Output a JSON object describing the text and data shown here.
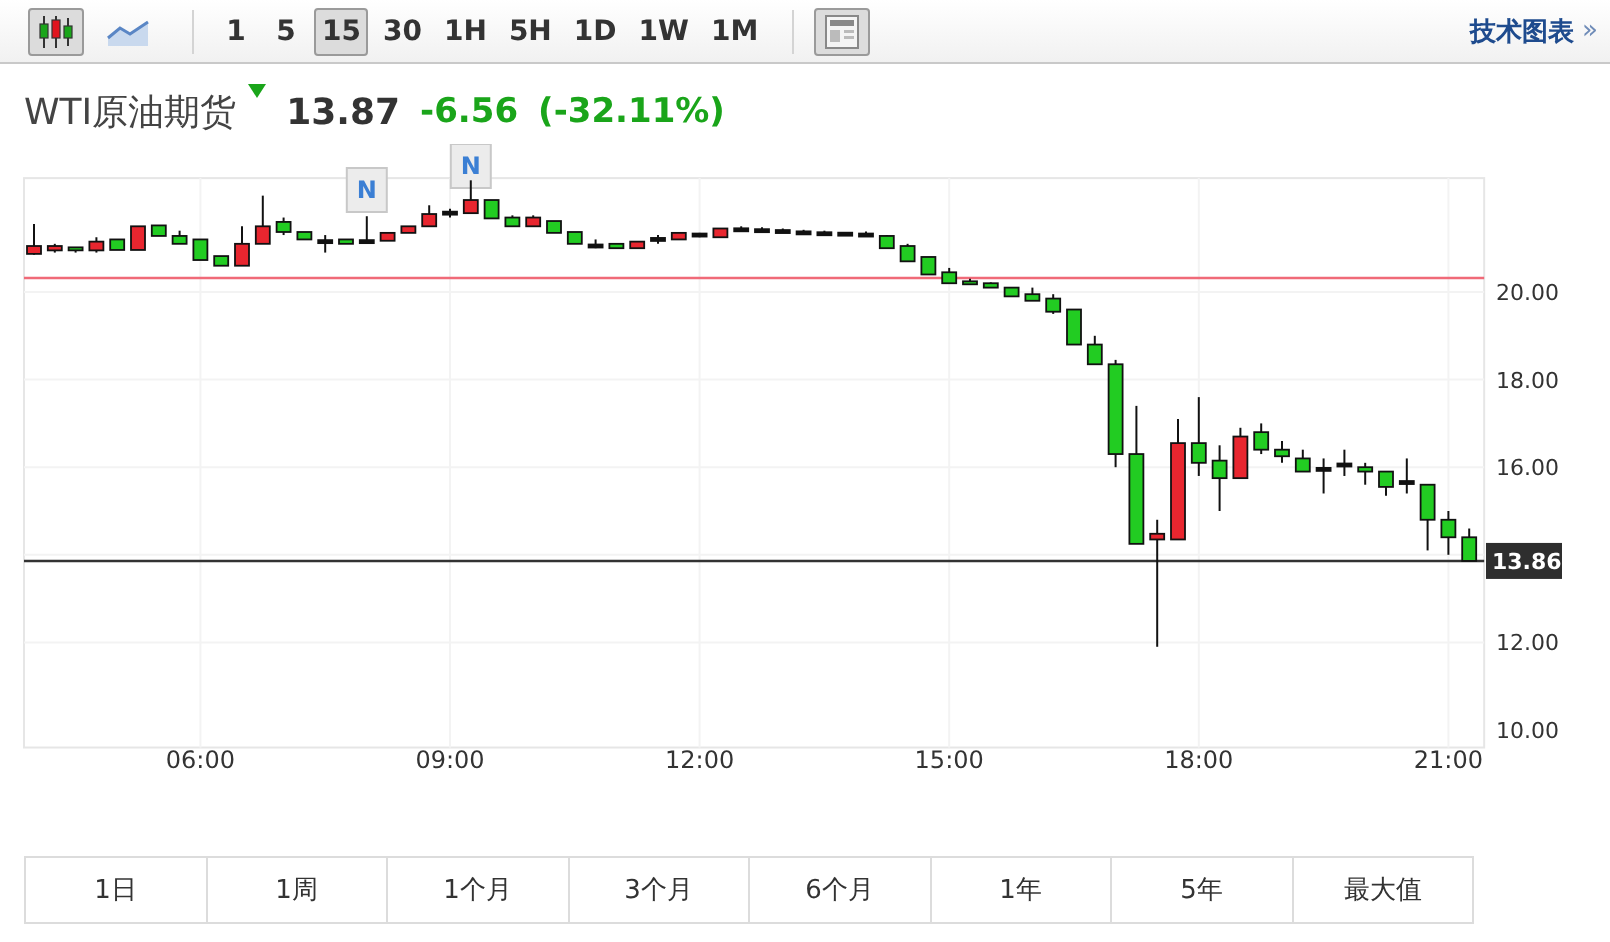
{
  "toolbar": {
    "chart_types": [
      {
        "kind": "candlestick",
        "selected": true
      },
      {
        "kind": "line",
        "selected": false
      }
    ],
    "intervals": [
      {
        "label": "1",
        "selected": false
      },
      {
        "label": "5",
        "selected": false
      },
      {
        "label": "15",
        "selected": true
      },
      {
        "label": "30",
        "selected": false
      },
      {
        "label": "1H",
        "selected": false
      },
      {
        "label": "5H",
        "selected": false
      },
      {
        "label": "1D",
        "selected": false
      },
      {
        "label": "1W",
        "selected": false
      },
      {
        "label": "1M",
        "selected": false
      }
    ],
    "link": "技术图表",
    "link_arrow": "»"
  },
  "quote": {
    "name": "WTI原油期货",
    "falling": true,
    "price": "13.87",
    "change": "-6.56",
    "change_percent": "(-32.11%)"
  },
  "chart": {
    "markers": [
      "N",
      "N"
    ],
    "last_price": "13.86",
    "chart_data": {
      "type": "candlestick",
      "x": [
        4,
        4.25,
        4.5,
        4.75,
        5,
        5.25,
        5.5,
        5.75,
        6,
        6.25,
        6.5,
        6.75,
        7,
        7.25,
        7.5,
        7.75,
        8,
        8.25,
        8.5,
        8.75,
        9,
        9.25,
        9.5,
        9.75,
        10,
        10.25,
        10.5,
        10.75,
        11,
        11.25,
        11.5,
        11.75,
        12,
        12.25,
        12.5,
        12.75,
        13,
        13.25,
        13.5,
        13.75,
        14,
        14.25,
        14.5,
        14.75,
        15,
        15.25,
        15.5,
        15.75,
        16,
        16.25,
        16.5,
        16.75,
        17,
        17.25,
        17.5,
        17.75,
        18,
        18.25,
        18.5,
        18.75,
        19,
        19.25,
        19.5,
        19.75,
        20,
        20.25,
        20.5,
        20.75,
        21,
        21.25
      ],
      "xlim": [
        3.88,
        21.43
      ],
      "ylim": [
        9.6,
        22.6
      ],
      "grid": true,
      "ref_lines": [
        {
          "axis": "y",
          "value": 20.32,
          "color": "#f06a78"
        },
        {
          "axis": "y",
          "value": 13.86,
          "color": "#333333"
        }
      ],
      "ohlc": [
        [
          20.87,
          21.55,
          20.85,
          21.05
        ],
        [
          20.95,
          21.1,
          20.9,
          21.05
        ],
        [
          21.0,
          21.02,
          20.9,
          20.97
        ],
        [
          20.95,
          21.25,
          20.9,
          21.15
        ],
        [
          21.2,
          21.2,
          20.96,
          20.96
        ],
        [
          20.96,
          21.5,
          20.96,
          21.5
        ],
        [
          21.52,
          21.52,
          21.28,
          21.28
        ],
        [
          21.28,
          21.4,
          21.1,
          21.1
        ],
        [
          21.2,
          21.2,
          20.73,
          20.73
        ],
        [
          20.82,
          20.82,
          20.6,
          20.6
        ],
        [
          20.6,
          21.5,
          20.6,
          21.1
        ],
        [
          21.1,
          22.2,
          21.1,
          21.5
        ],
        [
          21.6,
          21.7,
          21.3,
          21.37
        ],
        [
          21.37,
          21.37,
          21.2,
          21.2
        ],
        [
          21.15,
          21.3,
          20.9,
          21.15
        ],
        [
          21.2,
          21.2,
          21.1,
          21.1
        ],
        [
          21.15,
          21.73,
          21.15,
          21.15
        ],
        [
          21.17,
          21.35,
          21.17,
          21.35
        ],
        [
          21.35,
          21.5,
          21.35,
          21.5
        ],
        [
          21.5,
          21.98,
          21.5,
          21.78
        ],
        [
          21.8,
          21.9,
          21.7,
          21.8
        ],
        [
          21.8,
          22.55,
          21.8,
          22.1
        ],
        [
          22.1,
          22.1,
          21.68,
          21.68
        ],
        [
          21.7,
          21.75,
          21.5,
          21.5
        ],
        [
          21.5,
          21.75,
          21.5,
          21.7
        ],
        [
          21.62,
          21.62,
          21.35,
          21.35
        ],
        [
          21.37,
          21.37,
          21.1,
          21.1
        ],
        [
          21.05,
          21.2,
          21.0,
          21.05
        ],
        [
          21.1,
          21.1,
          21.0,
          21.0
        ],
        [
          21.0,
          21.15,
          21.0,
          21.15
        ],
        [
          21.2,
          21.3,
          21.1,
          21.2
        ],
        [
          21.2,
          21.35,
          21.2,
          21.35
        ],
        [
          21.3,
          21.35,
          21.25,
          21.3
        ],
        [
          21.25,
          21.45,
          21.25,
          21.45
        ],
        [
          21.42,
          21.5,
          21.42,
          21.42
        ],
        [
          21.4,
          21.48,
          21.4,
          21.4
        ],
        [
          21.38,
          21.45,
          21.38,
          21.38
        ],
        [
          21.35,
          21.42,
          21.35,
          21.35
        ],
        [
          21.33,
          21.4,
          21.33,
          21.33
        ],
        [
          21.32,
          21.35,
          21.32,
          21.32
        ],
        [
          21.3,
          21.38,
          21.3,
          21.3
        ],
        [
          21.28,
          21.3,
          21.0,
          21.0
        ],
        [
          21.05,
          21.1,
          20.7,
          20.7
        ],
        [
          20.8,
          20.8,
          20.4,
          20.4
        ],
        [
          20.45,
          20.55,
          20.2,
          20.2
        ],
        [
          20.22,
          20.3,
          20.2,
          20.2
        ],
        [
          20.2,
          20.22,
          20.1,
          20.1
        ],
        [
          20.1,
          20.1,
          19.9,
          19.9
        ],
        [
          19.95,
          20.1,
          19.8,
          19.8
        ],
        [
          19.85,
          19.95,
          19.5,
          19.55
        ],
        [
          19.6,
          19.6,
          18.8,
          18.8
        ],
        [
          18.8,
          19.0,
          18.35,
          18.35
        ],
        [
          18.35,
          18.45,
          16.0,
          16.3
        ],
        [
          16.3,
          17.4,
          14.25,
          14.25
        ],
        [
          14.35,
          14.8,
          11.9,
          14.48
        ],
        [
          14.35,
          17.1,
          14.35,
          16.55
        ],
        [
          16.55,
          17.6,
          15.8,
          16.1
        ],
        [
          16.15,
          16.5,
          15.0,
          15.75
        ],
        [
          15.75,
          16.9,
          15.75,
          16.7
        ],
        [
          16.8,
          17.0,
          16.3,
          16.4
        ],
        [
          16.4,
          16.6,
          16.1,
          16.25
        ],
        [
          16.2,
          16.4,
          15.9,
          15.9
        ],
        [
          15.95,
          16.2,
          15.4,
          15.95
        ],
        [
          16.05,
          16.4,
          15.8,
          16.05
        ],
        [
          16.0,
          16.1,
          15.6,
          15.9
        ],
        [
          15.9,
          15.9,
          15.35,
          15.55
        ],
        [
          15.65,
          16.2,
          15.4,
          15.65
        ],
        [
          15.6,
          15.6,
          14.1,
          14.8
        ],
        [
          14.8,
          15.0,
          14.0,
          14.4
        ],
        [
          14.4,
          14.6,
          13.86,
          13.86
        ]
      ],
      "xticks": [
        {
          "value": 6,
          "label": "06:00"
        },
        {
          "value": 9,
          "label": "09:00"
        },
        {
          "value": 12,
          "label": "12:00"
        },
        {
          "value": 15,
          "label": "15:00"
        },
        {
          "value": 18,
          "label": "18:00"
        },
        {
          "value": 21,
          "label": "21:00"
        }
      ],
      "yticks": [
        {
          "value": 20,
          "label": "20.00"
        },
        {
          "value": 18,
          "label": "18.00"
        },
        {
          "value": 16,
          "label": "16.00"
        },
        {
          "value": 12,
          "label": "12.00"
        },
        {
          "value": 10,
          "label": "10.00"
        }
      ]
    }
  },
  "ranges": [
    "1日",
    "1周",
    "1个月",
    "3个月",
    "6个月",
    "1年",
    "5年",
    "最大值"
  ]
}
